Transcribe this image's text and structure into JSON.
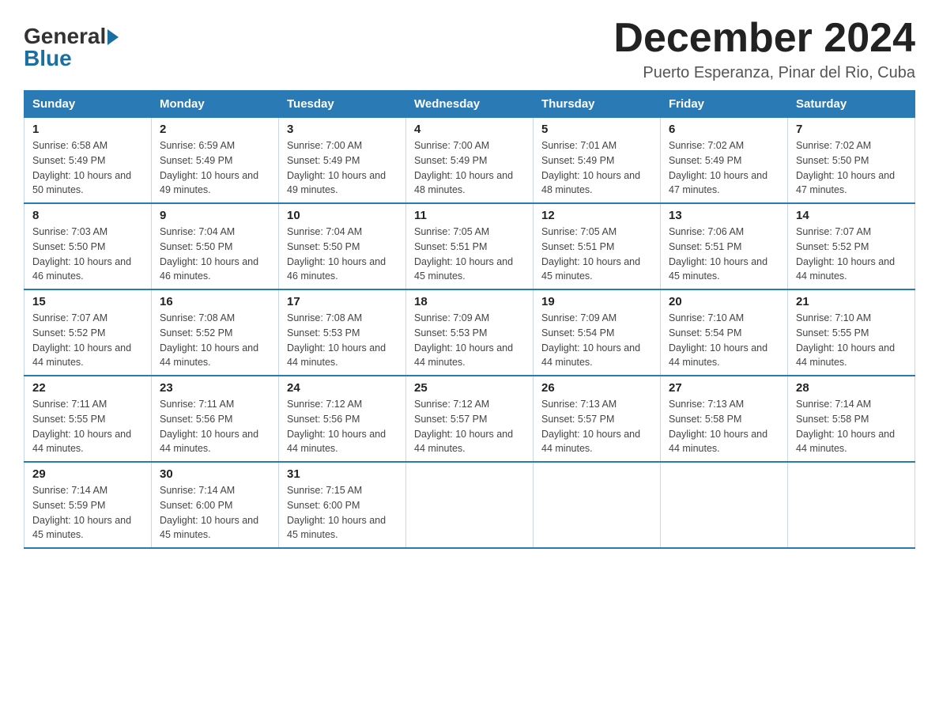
{
  "header": {
    "logo_general": "General",
    "logo_blue": "Blue",
    "title": "December 2024",
    "subtitle": "Puerto Esperanza, Pinar del Rio, Cuba"
  },
  "days_of_week": [
    "Sunday",
    "Monday",
    "Tuesday",
    "Wednesday",
    "Thursday",
    "Friday",
    "Saturday"
  ],
  "weeks": [
    [
      {
        "day": "1",
        "sunrise": "6:58 AM",
        "sunset": "5:49 PM",
        "daylight": "10 hours and 50 minutes."
      },
      {
        "day": "2",
        "sunrise": "6:59 AM",
        "sunset": "5:49 PM",
        "daylight": "10 hours and 49 minutes."
      },
      {
        "day": "3",
        "sunrise": "7:00 AM",
        "sunset": "5:49 PM",
        "daylight": "10 hours and 49 minutes."
      },
      {
        "day": "4",
        "sunrise": "7:00 AM",
        "sunset": "5:49 PM",
        "daylight": "10 hours and 48 minutes."
      },
      {
        "day": "5",
        "sunrise": "7:01 AM",
        "sunset": "5:49 PM",
        "daylight": "10 hours and 48 minutes."
      },
      {
        "day": "6",
        "sunrise": "7:02 AM",
        "sunset": "5:49 PM",
        "daylight": "10 hours and 47 minutes."
      },
      {
        "day": "7",
        "sunrise": "7:02 AM",
        "sunset": "5:50 PM",
        "daylight": "10 hours and 47 minutes."
      }
    ],
    [
      {
        "day": "8",
        "sunrise": "7:03 AM",
        "sunset": "5:50 PM",
        "daylight": "10 hours and 46 minutes."
      },
      {
        "day": "9",
        "sunrise": "7:04 AM",
        "sunset": "5:50 PM",
        "daylight": "10 hours and 46 minutes."
      },
      {
        "day": "10",
        "sunrise": "7:04 AM",
        "sunset": "5:50 PM",
        "daylight": "10 hours and 46 minutes."
      },
      {
        "day": "11",
        "sunrise": "7:05 AM",
        "sunset": "5:51 PM",
        "daylight": "10 hours and 45 minutes."
      },
      {
        "day": "12",
        "sunrise": "7:05 AM",
        "sunset": "5:51 PM",
        "daylight": "10 hours and 45 minutes."
      },
      {
        "day": "13",
        "sunrise": "7:06 AM",
        "sunset": "5:51 PM",
        "daylight": "10 hours and 45 minutes."
      },
      {
        "day": "14",
        "sunrise": "7:07 AM",
        "sunset": "5:52 PM",
        "daylight": "10 hours and 44 minutes."
      }
    ],
    [
      {
        "day": "15",
        "sunrise": "7:07 AM",
        "sunset": "5:52 PM",
        "daylight": "10 hours and 44 minutes."
      },
      {
        "day": "16",
        "sunrise": "7:08 AM",
        "sunset": "5:52 PM",
        "daylight": "10 hours and 44 minutes."
      },
      {
        "day": "17",
        "sunrise": "7:08 AM",
        "sunset": "5:53 PM",
        "daylight": "10 hours and 44 minutes."
      },
      {
        "day": "18",
        "sunrise": "7:09 AM",
        "sunset": "5:53 PM",
        "daylight": "10 hours and 44 minutes."
      },
      {
        "day": "19",
        "sunrise": "7:09 AM",
        "sunset": "5:54 PM",
        "daylight": "10 hours and 44 minutes."
      },
      {
        "day": "20",
        "sunrise": "7:10 AM",
        "sunset": "5:54 PM",
        "daylight": "10 hours and 44 minutes."
      },
      {
        "day": "21",
        "sunrise": "7:10 AM",
        "sunset": "5:55 PM",
        "daylight": "10 hours and 44 minutes."
      }
    ],
    [
      {
        "day": "22",
        "sunrise": "7:11 AM",
        "sunset": "5:55 PM",
        "daylight": "10 hours and 44 minutes."
      },
      {
        "day": "23",
        "sunrise": "7:11 AM",
        "sunset": "5:56 PM",
        "daylight": "10 hours and 44 minutes."
      },
      {
        "day": "24",
        "sunrise": "7:12 AM",
        "sunset": "5:56 PM",
        "daylight": "10 hours and 44 minutes."
      },
      {
        "day": "25",
        "sunrise": "7:12 AM",
        "sunset": "5:57 PM",
        "daylight": "10 hours and 44 minutes."
      },
      {
        "day": "26",
        "sunrise": "7:13 AM",
        "sunset": "5:57 PM",
        "daylight": "10 hours and 44 minutes."
      },
      {
        "day": "27",
        "sunrise": "7:13 AM",
        "sunset": "5:58 PM",
        "daylight": "10 hours and 44 minutes."
      },
      {
        "day": "28",
        "sunrise": "7:14 AM",
        "sunset": "5:58 PM",
        "daylight": "10 hours and 44 minutes."
      }
    ],
    [
      {
        "day": "29",
        "sunrise": "7:14 AM",
        "sunset": "5:59 PM",
        "daylight": "10 hours and 45 minutes."
      },
      {
        "day": "30",
        "sunrise": "7:14 AM",
        "sunset": "6:00 PM",
        "daylight": "10 hours and 45 minutes."
      },
      {
        "day": "31",
        "sunrise": "7:15 AM",
        "sunset": "6:00 PM",
        "daylight": "10 hours and 45 minutes."
      },
      null,
      null,
      null,
      null
    ]
  ]
}
